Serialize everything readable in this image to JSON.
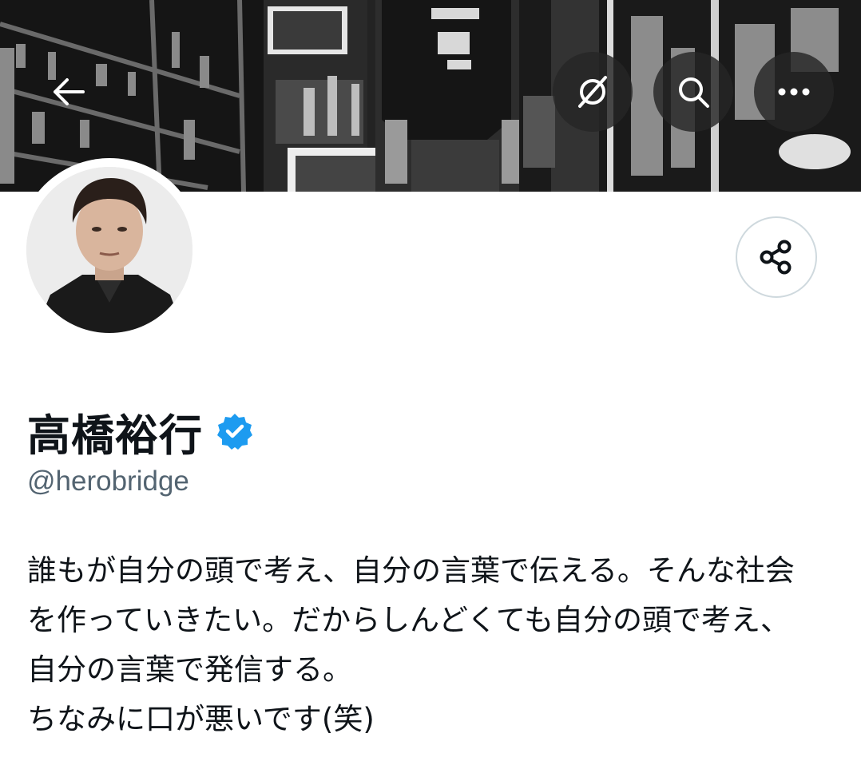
{
  "header": {
    "back_icon": "arrow-left-icon",
    "translate_icon": "translate-icon",
    "search_icon": "search-icon",
    "more_icon": "more-horizontal-icon",
    "button_bg": "#262626"
  },
  "profile": {
    "display_name": "高橋裕行",
    "verified_icon": "verified-badge-icon",
    "verified_color": "#1d9bf0",
    "handle": "@herobridge",
    "share_icon": "share-icon",
    "bio_lines": [
      "誰もが自分の頭で考え、自分の言葉で伝える。そんな社会",
      "を作っていきたい。だからしんどくても自分の頭で考え、",
      "自分の言葉で発信する。",
      "ちなみに口が悪いです(笑)"
    ]
  },
  "colors": {
    "text_primary": "#0f1419",
    "text_secondary": "#536471",
    "border": "#cfd9de"
  }
}
